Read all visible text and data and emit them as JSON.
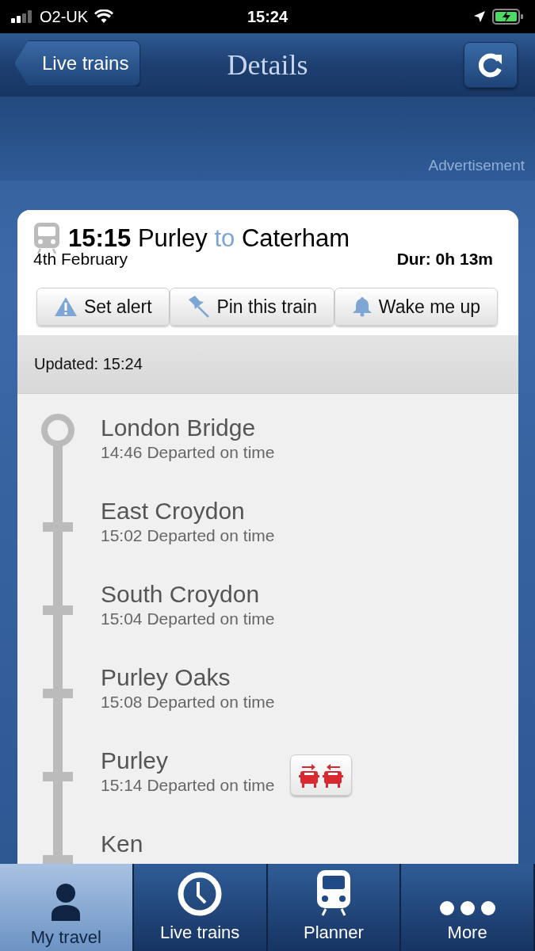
{
  "status_bar": {
    "carrier": "O2-UK",
    "time": "15:24"
  },
  "nav_bar": {
    "back_button": "Live trains",
    "title": "Details"
  },
  "advertisement": {
    "label": "Advertisement"
  },
  "train": {
    "time": "15:15",
    "origin": "Purley",
    "connector": "to",
    "destination": "Caterham",
    "date": "4th February",
    "duration": "Dur: 0h 13m"
  },
  "actions": [
    {
      "kind": "alert",
      "label": "Set alert"
    },
    {
      "kind": "pin",
      "label": "Pin this train"
    },
    {
      "kind": "bell",
      "label": "Wake me up"
    }
  ],
  "updated": "Updated: 15:24",
  "stops": [
    {
      "kind": "origin",
      "name": "London Bridge",
      "status": "14:46 Departed on time"
    },
    {
      "kind": "stop",
      "name": "East Croydon",
      "status": "15:02 Departed on time"
    },
    {
      "kind": "stop",
      "name": "South Croydon",
      "status": "15:04 Departed on time"
    },
    {
      "kind": "stop",
      "name": "Purley Oaks",
      "status": "15:08 Departed on time"
    },
    {
      "kind": "change",
      "name": "Purley",
      "status": "15:14 Departed on time"
    },
    {
      "kind": "stop",
      "name": "Ken"
    }
  ],
  "tabs": [
    {
      "kind": "person",
      "label": "My travel",
      "selected": true
    },
    {
      "kind": "clock",
      "label": "Live trains",
      "selected": false
    },
    {
      "kind": "train",
      "label": "Planner",
      "selected": false
    },
    {
      "kind": "more",
      "label": "More",
      "selected": false
    }
  ]
}
